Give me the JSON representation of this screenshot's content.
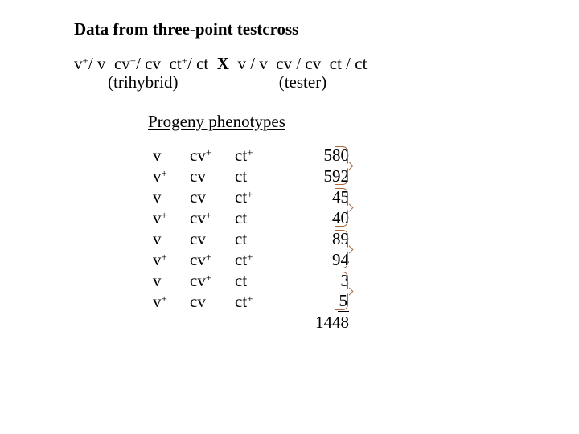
{
  "title": "Data from three-point testcross",
  "cross": {
    "trihybrid_v": "v",
    "trihybrid_cv": "cv",
    "trihybrid_ct": "ct",
    "x_symbol": "X",
    "tester_v": "v / v",
    "tester_cv": "cv / cv",
    "tester_ct": "ct / ct",
    "trihybrid_label": "(trihybrid)",
    "tester_label": "(tester)"
  },
  "progeny_heading": "Progeny phenotypes",
  "rows": [
    {
      "v": "v",
      "cv": "cv+",
      "ct": "ct+",
      "count": "580"
    },
    {
      "v": "v+",
      "cv": "cv",
      "ct": "ct",
      "count": "592"
    },
    {
      "v": "v",
      "cv": "cv",
      "ct": "ct+",
      "count": "45"
    },
    {
      "v": "v+",
      "cv": "cv+",
      "ct": "ct",
      "count": "40"
    },
    {
      "v": "v",
      "cv": "cv",
      "ct": "ct",
      "count": "89"
    },
    {
      "v": "v+",
      "cv": "cv+",
      "ct": "ct+",
      "count": "94"
    },
    {
      "v": "v",
      "cv": "cv+",
      "ct": "ct",
      "count": "3"
    },
    {
      "v": "v+",
      "cv": "cv",
      "ct": "ct+",
      "count": "5"
    }
  ],
  "total": "1448"
}
